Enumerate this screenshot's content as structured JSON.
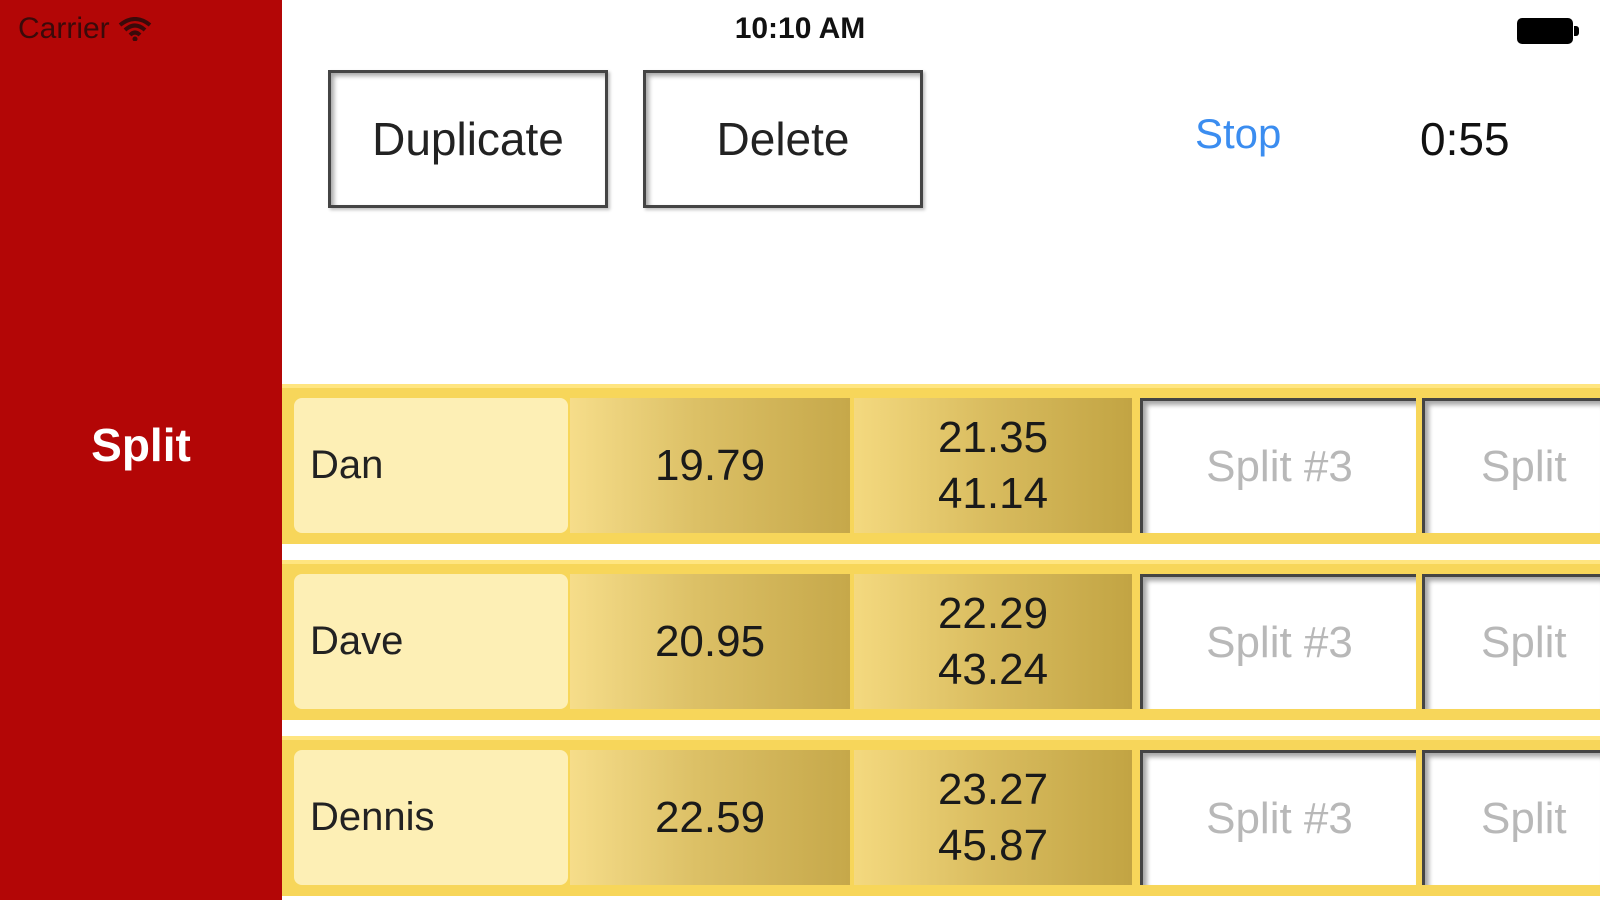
{
  "status_bar": {
    "carrier": "Carrier",
    "time": "10:10 AM"
  },
  "sidebar": {
    "title": "Split",
    "background_color": "#b30606"
  },
  "toolbar": {
    "duplicate_label": "Duplicate",
    "delete_label": "Delete",
    "stop_label": "Stop",
    "timer": "0:55",
    "stop_color": "#3b8df0"
  },
  "split_placeholders": {
    "split3": "Split #3",
    "split4": "Split"
  },
  "rows": [
    {
      "name": "Dan",
      "split1": "19.79",
      "split2_lap": "21.35",
      "split2_total": "41.14"
    },
    {
      "name": "Dave",
      "split1": "20.95",
      "split2_lap": "22.29",
      "split2_total": "43.24"
    },
    {
      "name": "Dennis",
      "split1": "22.59",
      "split2_lap": "23.27",
      "split2_total": "45.87"
    }
  ]
}
